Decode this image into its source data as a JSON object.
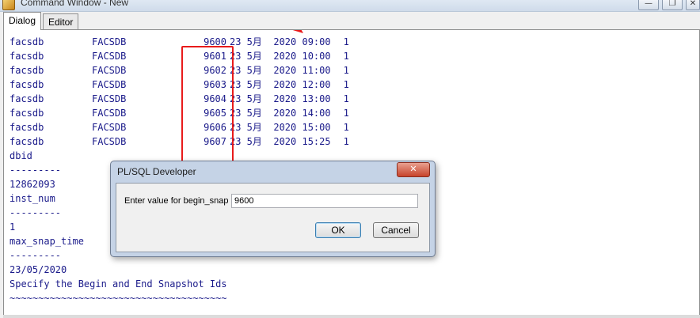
{
  "window": {
    "title": "Command Window - New",
    "minimize_glyph": "—",
    "restore_glyph": "❐",
    "close_glyph": "✕"
  },
  "tabs": [
    {
      "label": "Dialog",
      "active": true
    },
    {
      "label": "Editor",
      "active": false
    }
  ],
  "output": {
    "snap_rows": [
      {
        "instance": "facsdb",
        "db": "FACSDB",
        "snap_id": "9600",
        "date": "23 5月  2020 09:00",
        "level": "1"
      },
      {
        "instance": "facsdb",
        "db": "FACSDB",
        "snap_id": "9601",
        "date": "23 5月  2020 10:00",
        "level": "1"
      },
      {
        "instance": "facsdb",
        "db": "FACSDB",
        "snap_id": "9602",
        "date": "23 5月  2020 11:00",
        "level": "1"
      },
      {
        "instance": "facsdb",
        "db": "FACSDB",
        "snap_id": "9603",
        "date": "23 5月  2020 12:00",
        "level": "1"
      },
      {
        "instance": "facsdb",
        "db": "FACSDB",
        "snap_id": "9604",
        "date": "23 5月  2020 13:00",
        "level": "1"
      },
      {
        "instance": "facsdb",
        "db": "FACSDB",
        "snap_id": "9605",
        "date": "23 5月  2020 14:00",
        "level": "1"
      },
      {
        "instance": "facsdb",
        "db": "FACSDB",
        "snap_id": "9606",
        "date": "23 5月  2020 15:00",
        "level": "1"
      },
      {
        "instance": "facsdb",
        "db": "FACSDB",
        "snap_id": "9607",
        "date": "23 5月  2020 15:25",
        "level": "1"
      }
    ],
    "text_lines": [
      "dbid",
      "---------",
      "12862093",
      "inst_num",
      "---------",
      "1",
      "max_snap_time",
      "---------",
      "23/05/2020",
      "Specify the Begin and End Snapshot Ids",
      "~~~~~~~~~~~~~~~~~~~~~~~~~~~~~~~~~~~~~~"
    ]
  },
  "annotation": {
    "color": "#e81b1b"
  },
  "dialog": {
    "title": "PL/SQL Developer",
    "close_glyph": "✕",
    "prompt_label": "Enter value for begin_snap",
    "input_value": "9600",
    "ok_label": "OK",
    "cancel_label": "Cancel"
  }
}
